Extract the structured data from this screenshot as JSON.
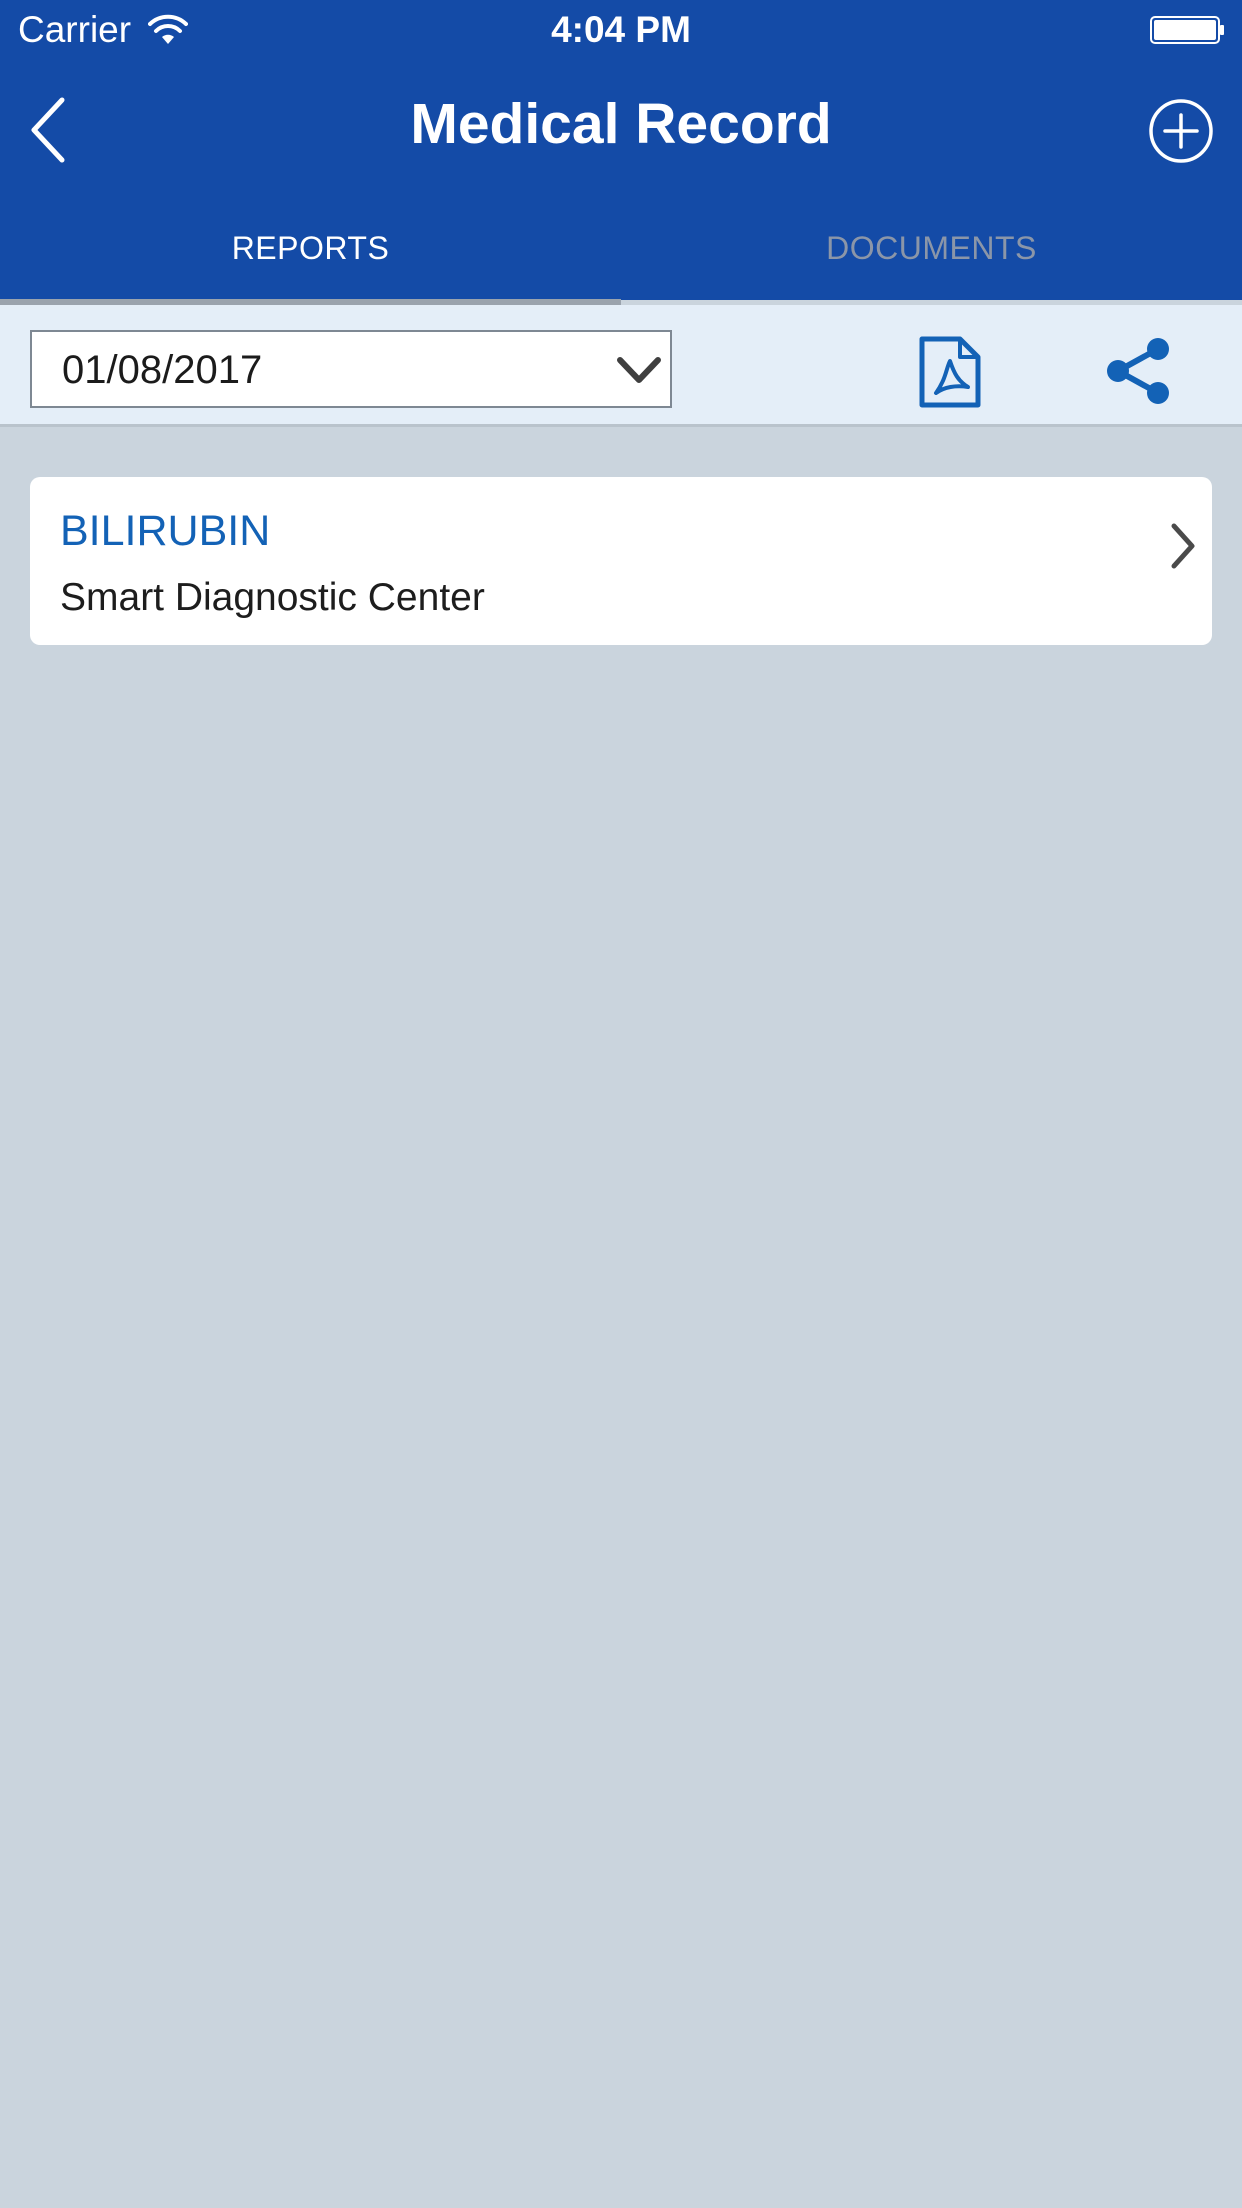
{
  "status_bar": {
    "carrier": "Carrier",
    "time": "4:04 PM",
    "icons": [
      "wifi-icon",
      "battery-icon"
    ]
  },
  "nav": {
    "title": "Medical Record",
    "back_icon": "back-chevron-icon",
    "add_icon": "plus-circle-icon"
  },
  "tabs": [
    {
      "label": "REPORTS",
      "selected": true
    },
    {
      "label": "DOCUMENTS",
      "selected": false
    }
  ],
  "toolbar": {
    "date_value": "01/08/2017",
    "pdf_icon": "pdf-icon",
    "share_icon": "share-icon"
  },
  "reports": [
    {
      "title": "BILIRUBIN",
      "subtitle": "Smart Diagnostic Center"
    }
  ],
  "colors": {
    "header_bg": "#144ba7",
    "accent": "#1362b6",
    "toolbar_bg": "#e4eef8",
    "page_bg": "#cad4dd",
    "inactive_tab": "#8b96a8"
  }
}
